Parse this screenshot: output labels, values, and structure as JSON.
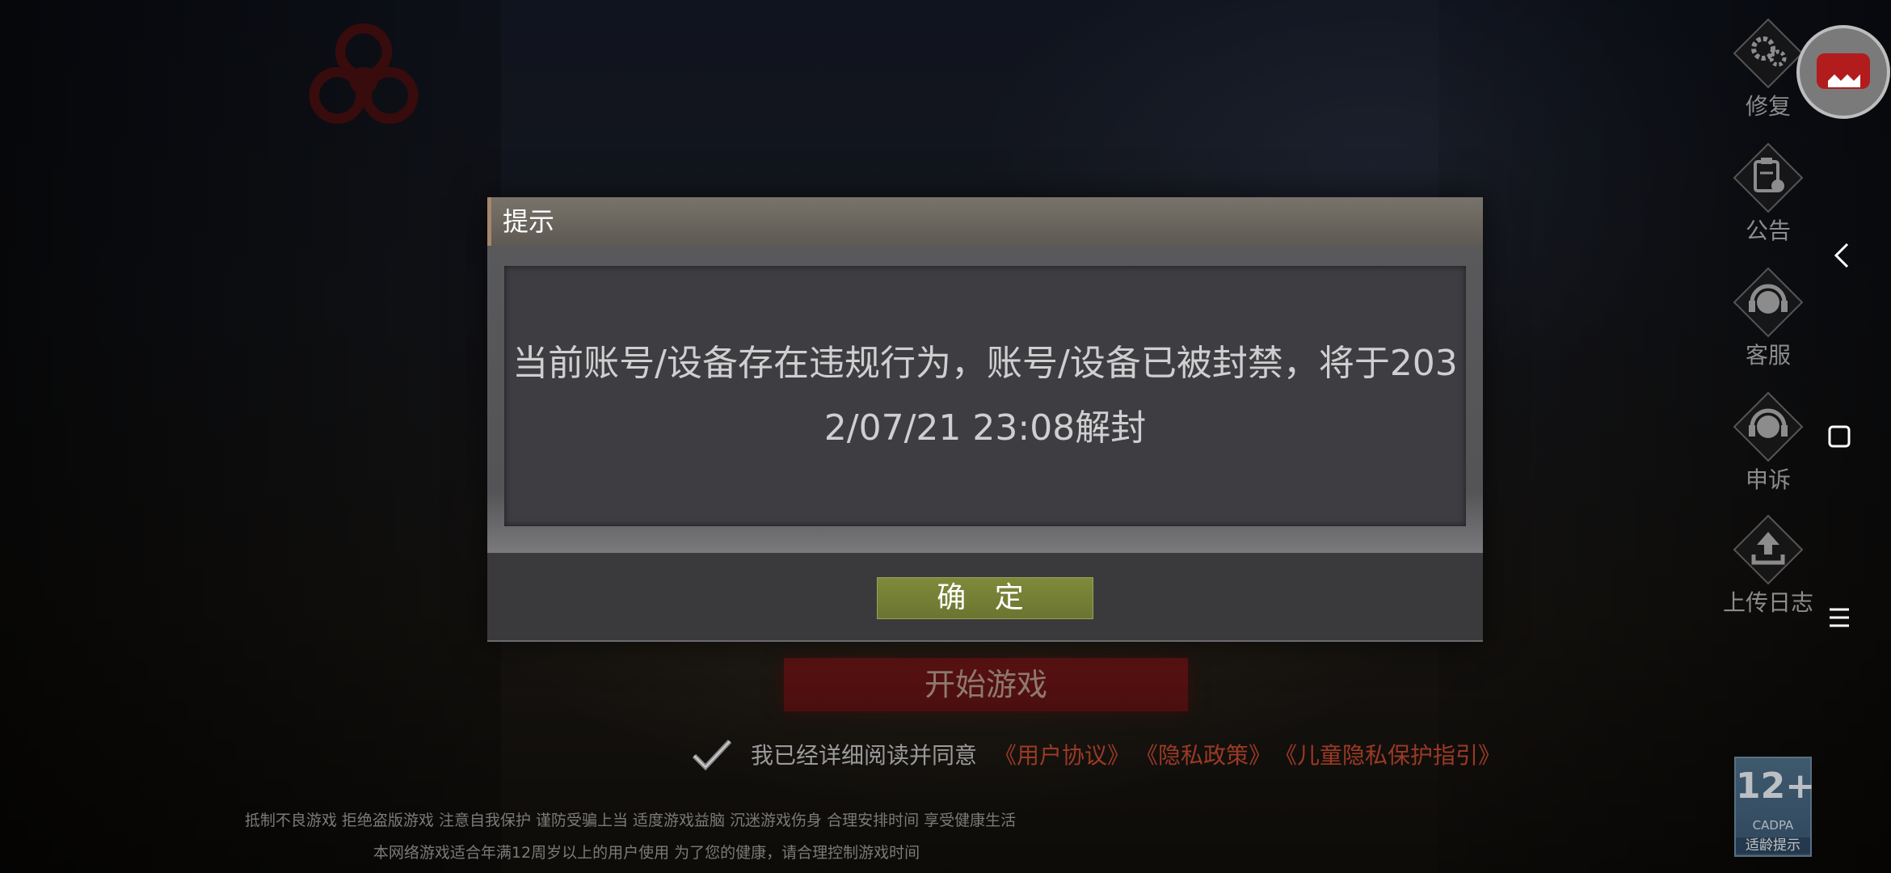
{
  "dialog": {
    "title": "提示",
    "message": "当前账号/设备存在违规行为，账号/设备已被封禁，将于2032/07/21 23:08解封",
    "confirm_label": "确 定"
  },
  "start_button": {
    "label": "开始游戏"
  },
  "agreement": {
    "text": "我已经详细阅读并同意",
    "user_agreement": "《用户协议》",
    "privacy_policy": "《隐私政策》",
    "child_privacy": "《儿童隐私保护指引》"
  },
  "notices": {
    "line1": "抵制不良游戏 拒绝盗版游戏 注意自我保护 谨防受骗上当 适度游戏益脑 沉迷游戏伤身 合理安排时间 享受健康生活",
    "line2": "本网络游戏适合年满12周岁以上的用户使用   为了您的健康，请合理控制游戏时间"
  },
  "side_menu": {
    "repair": "修复",
    "announcement": "公告",
    "customer_service": "客服",
    "appeal": "申诉",
    "upload_log": "上传日志"
  },
  "age_rating": {
    "value": "12+",
    "org": "CADPA",
    "label": "适龄提示"
  },
  "icons": {
    "repair": "gear-icon",
    "announcement": "clipboard-icon",
    "customer_service": "headset-icon",
    "appeal": "headset-icon",
    "upload_log": "upload-icon",
    "nav_back": "chevron-left-icon",
    "nav_home": "square-icon",
    "nav_menu": "menu-icon"
  },
  "colors": {
    "confirm_button": "#7f8a3b",
    "link": "#9b3a24",
    "start_button": "#5b1313"
  }
}
